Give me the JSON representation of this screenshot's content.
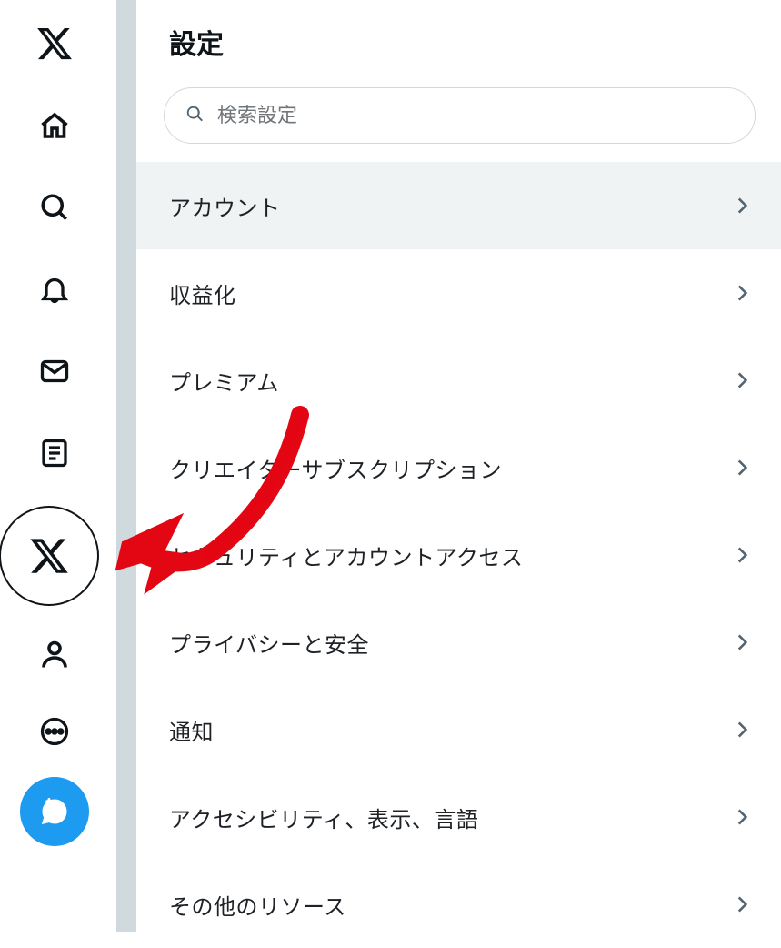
{
  "sidebar": {
    "items": [
      {
        "name": "x-logo-icon"
      },
      {
        "name": "home-icon"
      },
      {
        "name": "search-icon"
      },
      {
        "name": "notifications-icon"
      },
      {
        "name": "messages-icon"
      },
      {
        "name": "lists-icon"
      },
      {
        "name": "account-switcher"
      },
      {
        "name": "profile-icon"
      },
      {
        "name": "more-icon"
      }
    ],
    "compose_label": "投稿する"
  },
  "page": {
    "title": "設定"
  },
  "search": {
    "placeholder": "検索設定",
    "value": ""
  },
  "settings": {
    "items": [
      {
        "label": "アカウント",
        "selected": true
      },
      {
        "label": "収益化",
        "selected": false
      },
      {
        "label": "プレミアム",
        "selected": false
      },
      {
        "label": "クリエイターサブスクリプション",
        "selected": false
      },
      {
        "label": "セキュリティとアカウントアクセス",
        "selected": false
      },
      {
        "label": "プライバシーと安全",
        "selected": false
      },
      {
        "label": "通知",
        "selected": false
      },
      {
        "label": "アクセシビリティ、表示、言語",
        "selected": false
      },
      {
        "label": "その他のリソース",
        "selected": false
      }
    ]
  }
}
